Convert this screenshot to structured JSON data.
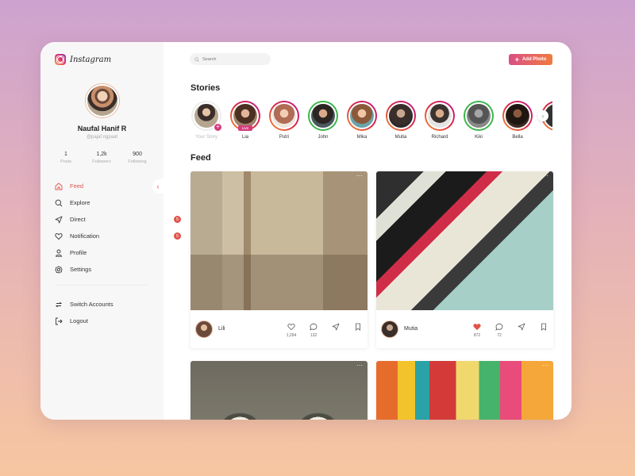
{
  "app": {
    "name": "Instagram"
  },
  "profile": {
    "name": "Naufal Hanif R",
    "handle": "@pajaf.ngpaat",
    "stats": [
      {
        "value": "1",
        "label": "Posts"
      },
      {
        "value": "1,2k",
        "label": "Followers"
      },
      {
        "value": "900",
        "label": "Following"
      }
    ]
  },
  "nav": {
    "items": [
      {
        "label": "Feed",
        "icon": "home-icon",
        "active": true
      },
      {
        "label": "Explore",
        "icon": "search-icon"
      },
      {
        "label": "Direct",
        "icon": "send-icon",
        "badge": "5"
      },
      {
        "label": "Notification",
        "icon": "heart-icon",
        "badge": "5"
      },
      {
        "label": "Profile",
        "icon": "user-icon"
      },
      {
        "label": "Settings",
        "icon": "gear-icon"
      }
    ],
    "secondary": [
      {
        "label": "Switch Accounts",
        "icon": "switch-icon"
      },
      {
        "label": "Logout",
        "icon": "logout-icon"
      }
    ]
  },
  "search": {
    "placeholder": "Search"
  },
  "header": {
    "add_photo_label": "Add Photo"
  },
  "stories": {
    "title": "Stories",
    "items": [
      {
        "name": "Your Story",
        "own": true
      },
      {
        "name": "Lia",
        "live": true,
        "live_label": "Live"
      },
      {
        "name": "Putri"
      },
      {
        "name": "John"
      },
      {
        "name": "Mika"
      },
      {
        "name": "Mutia"
      },
      {
        "name": "Richard"
      },
      {
        "name": "Kiki"
      },
      {
        "name": "Bella"
      }
    ]
  },
  "feed": {
    "title": "Feed",
    "posts": [
      {
        "author": "Lili",
        "likes": "1,294",
        "comments": "132",
        "liked": false
      },
      {
        "author": "Mutia",
        "likes": "872",
        "comments": "72",
        "liked": true
      }
    ]
  },
  "colors": {
    "accent": "#e2534a",
    "brand_gradient_start": "#d94f86",
    "brand_gradient_end": "#f07a3e",
    "story_ring_pink": "#c13584",
    "story_ring_green": "#3bb54a"
  }
}
